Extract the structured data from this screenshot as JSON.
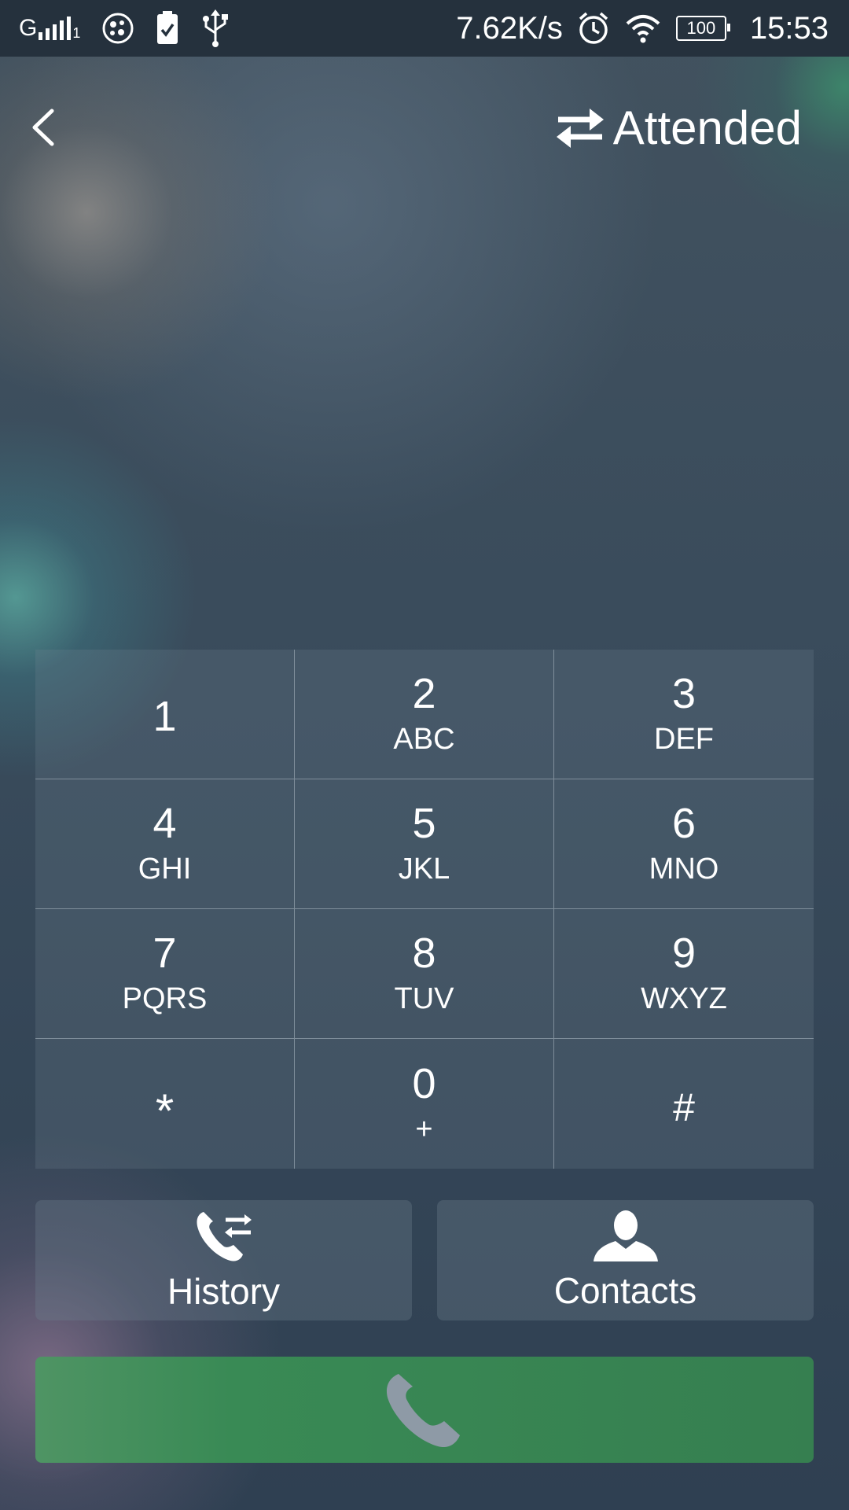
{
  "status_bar": {
    "signal_label": "G",
    "sim_slot": "1",
    "net_speed": "7.62K/s",
    "battery": "100",
    "time": "15:53"
  },
  "header": {
    "mode_label": "Attended",
    "mode_icon": "transfer-arrows-icon",
    "back_icon": "chevron-left-icon"
  },
  "keypad": [
    {
      "digit": "1",
      "letters": ""
    },
    {
      "digit": "2",
      "letters": "ABC"
    },
    {
      "digit": "3",
      "letters": "DEF"
    },
    {
      "digit": "4",
      "letters": "GHI"
    },
    {
      "digit": "5",
      "letters": "JKL"
    },
    {
      "digit": "6",
      "letters": "MNO"
    },
    {
      "digit": "7",
      "letters": "PQRS"
    },
    {
      "digit": "8",
      "letters": "TUV"
    },
    {
      "digit": "9",
      "letters": "WXYZ"
    },
    {
      "digit": "*",
      "letters": ""
    },
    {
      "digit": "0",
      "letters": "+"
    },
    {
      "digit": "#",
      "letters": ""
    }
  ],
  "actions": {
    "history_label": "History",
    "history_icon": "phone-transfer-icon",
    "contacts_label": "Contacts",
    "contacts_icon": "person-icon"
  },
  "call_button": {
    "icon": "phone-icon",
    "color": "#3a8a55"
  }
}
